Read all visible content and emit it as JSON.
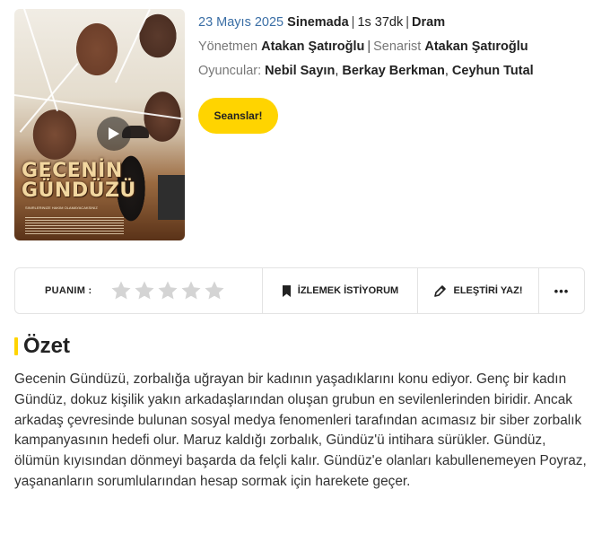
{
  "poster": {
    "title_line1": "GECENİN",
    "title_line2": "GÜNDÜZÜ",
    "tagline": "SINIRLERINIZE HAKIM OLAMAYACAKSINIZ"
  },
  "movie": {
    "release_date": "23 Mayıs 2025",
    "release_status": "Sinemada",
    "duration": "1s 37dk",
    "genre": "Dram",
    "director_label": "Yönetmen",
    "director": "Atakan Şatıroğlu",
    "writer_label": "Senarist",
    "writer": "Atakan Şatıroğlu",
    "cast_label": "Oyuncular:",
    "cast": [
      "Nebil Sayın",
      "Berkay Berkman",
      "Ceyhun Tutal"
    ]
  },
  "buttons": {
    "sessions": "Seanslar!"
  },
  "actionbar": {
    "rating_label": "PUANIM :",
    "rating_value": 0,
    "rating_max": 5,
    "watchlist": "İZLEMEK İSTİYORUM",
    "review": "ELEŞTİRİ YAZ!",
    "more": "•••"
  },
  "summary": {
    "heading": "Özet",
    "text": "Gecenin Gündüzü, zorbalığa uğrayan bir kadının yaşadıklarını konu ediyor. Genç bir kadın Gündüz, dokuz kişilik yakın arkadaşlarından oluşan grubun en sevilenlerinden biridir. Ancak arkadaş çevresinde bulunan sosyal medya fenomenleri tarafından acımasız bir siber zorbalık kampanyasının hedefi olur. Maruz kaldığı zorbalık, Gündüz'ü intihara sürükler. Gündüz, ölümün kıyısından dönmeyi başarda da felçli kalır. Gündüz'e olanları kabullenemeyen Poyraz, yaşananların sorumlularından hesap sormak için harekete geçer."
  },
  "colors": {
    "accent": "#ffd400",
    "date": "#3a6ea5",
    "star_empty": "#d4d4d4"
  }
}
